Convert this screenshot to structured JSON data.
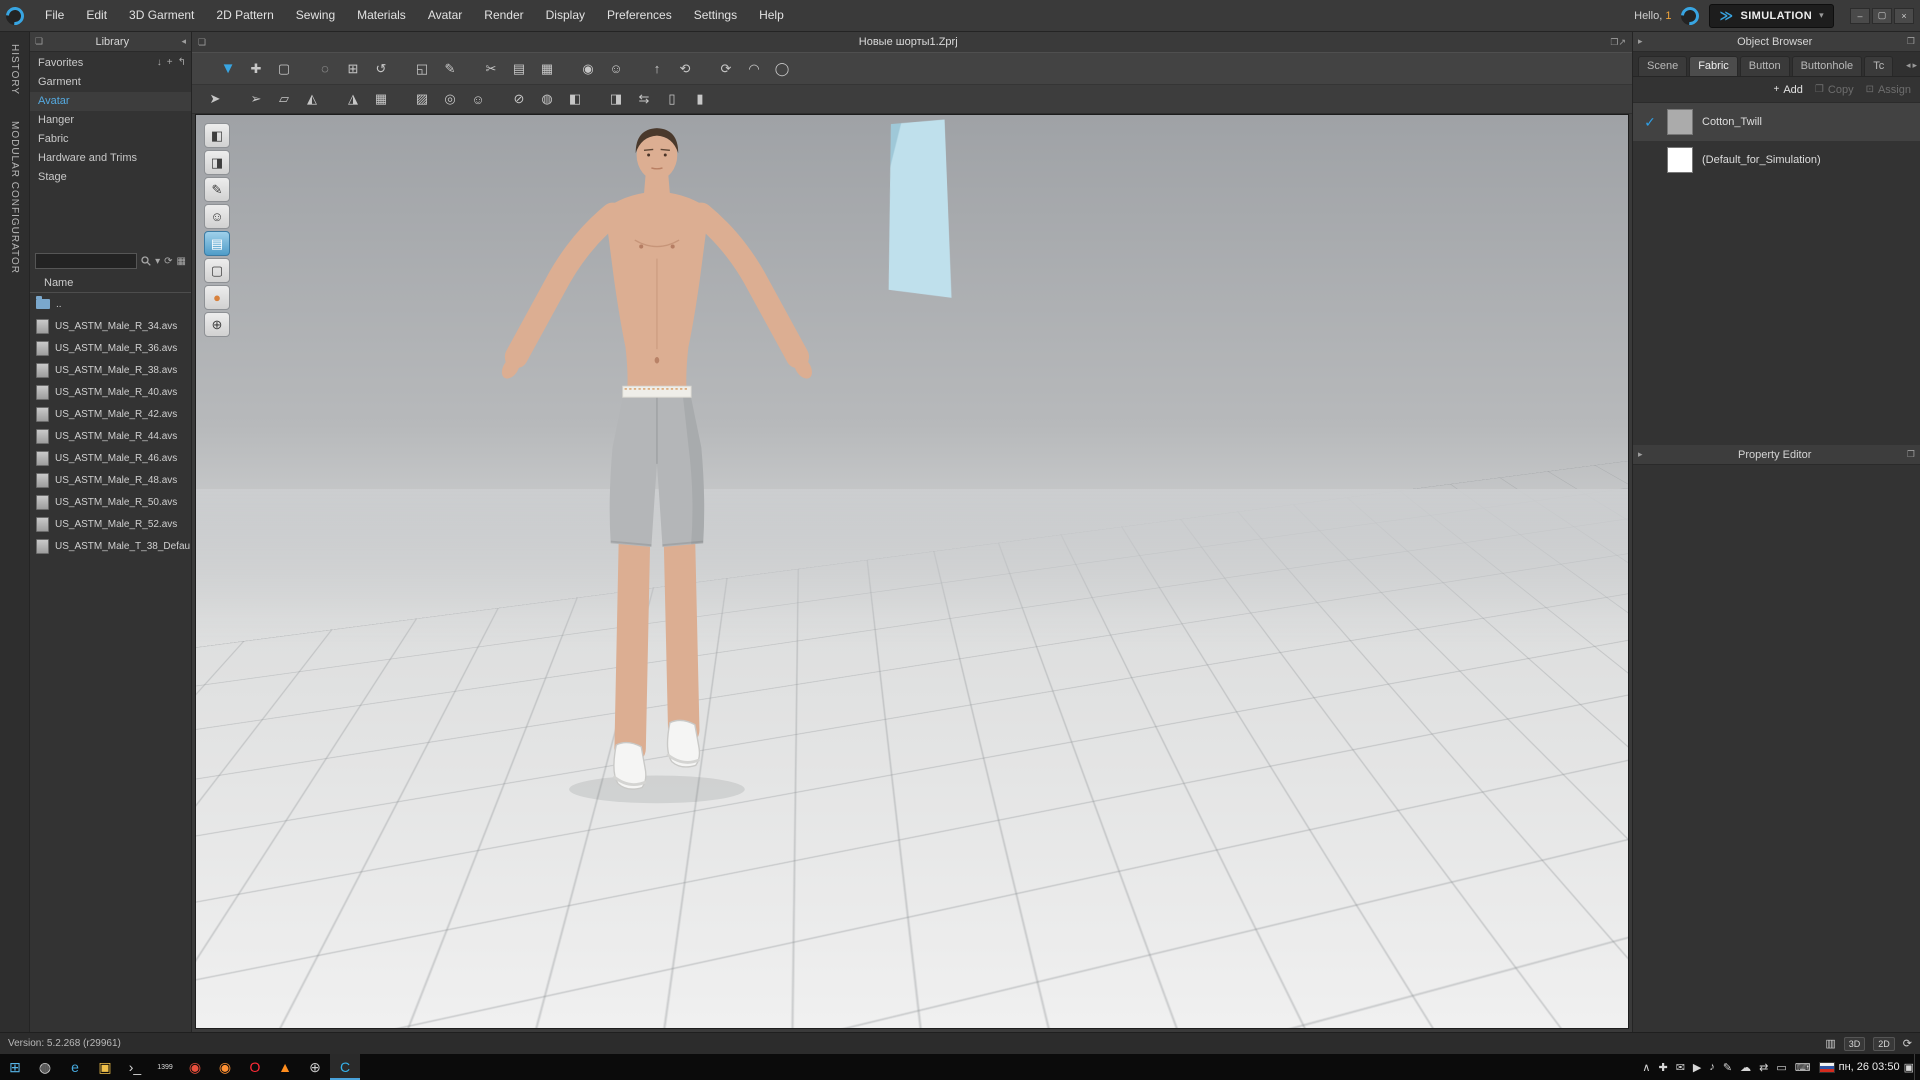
{
  "colors": {
    "accent_blue": "#38a5e2",
    "check_blue": "#2f9fe6",
    "fabric_piece": "#bfe0ec",
    "fabric_piece_edge": "#9fc8d8",
    "shorts": "#b4b6b8",
    "skin": "#dcae92",
    "viewport_top": "#9fa2a6",
    "viewport_bottom": "#f0f0f0",
    "waistband": "#efeee9",
    "stitch_orange": "#d89a5f",
    "shoe_white": "#f5f5f4",
    "hair": "#4a392c"
  },
  "menubar": {
    "items": [
      "File",
      "Edit",
      "3D Garment",
      "2D Pattern",
      "Sewing",
      "Materials",
      "Avatar",
      "Render",
      "Display",
      "Preferences",
      "Settings",
      "Help"
    ],
    "simulation_label": "SIMULATION",
    "window_controls": [
      {
        "name": "minimize-button",
        "glyph": "–"
      },
      {
        "name": "maximize-button",
        "glyph": "▢"
      },
      {
        "name": "close-button",
        "glyph": "×"
      }
    ]
  },
  "greeting": {
    "prefix": "Hello,",
    "user": "1"
  },
  "side_strip": {
    "tabs": [
      "HISTORY",
      "MODULAR CONFIGURATOR"
    ]
  },
  "library": {
    "title": "Library",
    "favorites_label": "Favorites",
    "favorites_icons": [
      {
        "name": "download-icon",
        "glyph": "↓"
      },
      {
        "name": "add-icon",
        "glyph": "+"
      },
      {
        "name": "back-icon",
        "glyph": "↰"
      }
    ],
    "categories": [
      {
        "label": "Garment"
      },
      {
        "label": "Avatar",
        "active": true
      },
      {
        "label": "Hanger"
      },
      {
        "label": "Fabric"
      },
      {
        "label": "Hardware and Trims"
      },
      {
        "label": "Stage"
      }
    ],
    "search_placeholder": "",
    "name_header": "Name",
    "parent_row": "..",
    "files": [
      "US_ASTM_Male_R_34.avs",
      "US_ASTM_Male_R_36.avs",
      "US_ASTM_Male_R_38.avs",
      "US_ASTM_Male_R_40.avs",
      "US_ASTM_Male_R_42.avs",
      "US_ASTM_Male_R_44.avs",
      "US_ASTM_Male_R_46.avs",
      "US_ASTM_Male_R_48.avs",
      "US_ASTM_Male_R_50.avs",
      "US_ASTM_Male_R_52.avs",
      "US_ASTM_Male_T_38_Defau"
    ]
  },
  "viewport": {
    "title": "Новые шорты1.Zprj",
    "toolbar_row1": [
      {
        "name": "simulate-icon",
        "glyph": "▼",
        "accent": true
      },
      {
        "name": "pan-icon",
        "glyph": "✚"
      },
      {
        "name": "marquee-select-icon",
        "glyph": "▢"
      },
      {
        "name": "lasso-select-icon",
        "glyph": "◌"
      },
      {
        "name": "move-gizmo-icon",
        "glyph": "⊞"
      },
      {
        "name": "rotate-gizmo-icon",
        "glyph": "↺"
      },
      {
        "name": "scale-gizmo-icon",
        "glyph": "◱"
      },
      {
        "name": "pen-icon",
        "glyph": "✎"
      },
      {
        "name": "scissors-icon",
        "glyph": "✂"
      },
      {
        "name": "pattern-icon",
        "glyph": "▤"
      },
      {
        "name": "arrangement-points-icon",
        "glyph": "▦"
      },
      {
        "name": "pins-icon",
        "glyph": "◉"
      },
      {
        "name": "avatar-icon",
        "glyph": "☺"
      },
      {
        "name": "lift-icon",
        "glyph": "↑"
      },
      {
        "name": "fold-left-icon",
        "glyph": "⟲"
      },
      {
        "name": "fold-right-icon",
        "glyph": "⟳"
      },
      {
        "name": "curve-icon",
        "glyph": "◠"
      },
      {
        "name": "ellipse-icon",
        "glyph": "◯"
      }
    ],
    "toolbar_row2": [
      {
        "name": "walk-pose-icon",
        "glyph": "➤"
      },
      {
        "name": "pose-edit-icon",
        "glyph": "➢"
      },
      {
        "name": "tape-measure-icon",
        "glyph": "▱"
      },
      {
        "name": "mesh-select-icon",
        "glyph": "◭"
      },
      {
        "name": "mesh-edit-icon",
        "glyph": "◮"
      },
      {
        "name": "grid-points-icon",
        "glyph": "▦"
      },
      {
        "name": "grid-points2-icon",
        "glyph": "▨"
      },
      {
        "name": "show-avatar-icon",
        "glyph": "◎"
      },
      {
        "name": "show-head-icon",
        "glyph": "☺"
      },
      {
        "name": "lock-avatar-icon",
        "glyph": "⊘"
      },
      {
        "name": "sphere-icon",
        "glyph": "◍"
      },
      {
        "name": "texture-a-icon",
        "glyph": "◧"
      },
      {
        "name": "texture-b-icon",
        "glyph": "◨"
      },
      {
        "name": "slider-icon",
        "glyph": "⇆"
      },
      {
        "name": "mirror-left-icon",
        "glyph": "▯"
      },
      {
        "name": "mirror-right-icon",
        "glyph": "▮"
      }
    ],
    "view_tools": [
      {
        "name": "snapshot-icon",
        "glyph": "◧"
      },
      {
        "name": "render-style-icon",
        "glyph": "◨"
      },
      {
        "name": "brush-icon",
        "glyph": "✎"
      },
      {
        "name": "avatar-show-icon",
        "glyph": "☺"
      },
      {
        "name": "fabric-view-icon",
        "glyph": "▤",
        "blue": true
      },
      {
        "name": "eraser-icon",
        "glyph": "▢"
      },
      {
        "name": "mannequin-icon",
        "glyph": "●",
        "orange": true
      },
      {
        "name": "globe-icon",
        "glyph": "⊕"
      }
    ]
  },
  "object_browser": {
    "title": "Object Browser",
    "tabs": [
      {
        "label": "Scene"
      },
      {
        "label": "Fabric",
        "active": true
      },
      {
        "label": "Button"
      },
      {
        "label": "Buttonhole"
      },
      {
        "label": "Tc"
      }
    ],
    "add_label": "Add",
    "copy_label": "Copy",
    "assign_label": "Assign",
    "fabrics": [
      {
        "name": "Cotton_Twill",
        "selected": true,
        "swatch": "#ababab"
      },
      {
        "name": "(Default_for_Simulation)",
        "selected": false,
        "swatch": "#ffffff"
      }
    ]
  },
  "property_editor": {
    "title": "Property Editor"
  },
  "statusbar": {
    "version": "Version: 5.2.268 (r29961)",
    "right_icons": [
      {
        "name": "dual-view-icon",
        "glyph": "▥"
      },
      {
        "name": "view-3d-button",
        "glyph": "3D",
        "toggle": true
      },
      {
        "name": "view-2d-button",
        "glyph": "2D",
        "toggle": true
      },
      {
        "name": "refresh-icon",
        "glyph": "⟳"
      }
    ]
  },
  "taskbar": {
    "apps": [
      {
        "name": "start-button",
        "glyph": "⊞",
        "color": "#57b5e8"
      },
      {
        "name": "cortana-icon",
        "glyph": "◍",
        "color": "#cfcfcf"
      },
      {
        "name": "edge-icon",
        "glyph": "e",
        "color": "#46aadf"
      },
      {
        "name": "file-explorer-icon",
        "glyph": "▣",
        "color": "#f0c04a"
      },
      {
        "name": "console-icon",
        "glyph": "›_",
        "color": "#d8d8d8"
      },
      {
        "name": "counter-icon",
        "glyph": "1399",
        "color": "#dddddd",
        "small": true
      },
      {
        "name": "chrome-icon",
        "glyph": "◉",
        "color": "#e94f3c"
      },
      {
        "name": "firefox-icon",
        "glyph": "◉",
        "color": "#ff9133"
      },
      {
        "name": "opera-icon",
        "glyph": "O",
        "color": "#ff2b37"
      },
      {
        "name": "media-player-icon",
        "glyph": "▲",
        "color": "#ff8d1d"
      },
      {
        "name": "globe-icon",
        "glyph": "⊕",
        "color": "#c9c9c9"
      },
      {
        "name": "clo-icon",
        "glyph": "C",
        "color": "#35b1ea",
        "active": true
      }
    ],
    "tray": [
      {
        "name": "hidden-icons-chevron-icon",
        "glyph": "∧"
      },
      {
        "name": "shield-icon",
        "glyph": "✚"
      },
      {
        "name": "mail-icon",
        "glyph": "✉"
      },
      {
        "name": "play-icon",
        "glyph": "▶"
      },
      {
        "name": "volume-icon",
        "glyph": "♪"
      },
      {
        "name": "pen-icon",
        "glyph": "✎"
      },
      {
        "name": "cloud-icon",
        "glyph": "☁"
      },
      {
        "name": "network-icon",
        "glyph": "⇄"
      },
      {
        "name": "display-icon",
        "glyph": "▭"
      },
      {
        "name": "keyboard-icon",
        "glyph": "⌨"
      }
    ],
    "datetime": "пн, 26 03:50",
    "notification_icon": "▣"
  }
}
